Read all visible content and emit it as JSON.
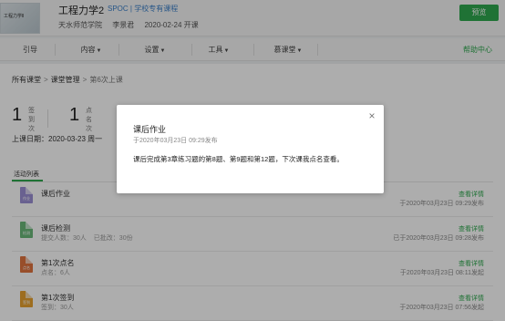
{
  "header": {
    "thumb_text": "工程力学Ⅱ",
    "course_title": "工程力学2",
    "spoc_tag": "SPOC | 学校专有课程",
    "school": "天水师范学院",
    "teacher": "李景君",
    "start": "2020-02-24 开课",
    "preview_label": "预览"
  },
  "nav": {
    "items": [
      "引导",
      "内容",
      "设置",
      "工具",
      "慕课堂"
    ],
    "help_label": "帮助中心"
  },
  "breadcrumb": {
    "root": "所有课堂",
    "mid": "课堂管理",
    "current": "第6次上课"
  },
  "stats": [
    {
      "num": "1",
      "l1": "签到",
      "l2": "次"
    },
    {
      "num": "1",
      "l1": "点名",
      "l2": "次"
    }
  ],
  "class_date": "上课日期：2020-03-23 周一",
  "tab_label": "活动列表",
  "activities": [
    {
      "icon_label": "作业",
      "color": "#9b8fd4",
      "title": "课后作业",
      "sub": [],
      "link": "查看详情",
      "time": "于2020年03月23日 09:29发布"
    },
    {
      "icon_label": "检测",
      "color": "#6ab97a",
      "title": "课后检测",
      "sub": [
        "提交人数：30人",
        "已批改：30份"
      ],
      "link": "查看详情",
      "time": "已于2020年03月23日 09:28发布"
    },
    {
      "icon_label": "点名",
      "color": "#e0733e",
      "title": "第1次点名",
      "sub": [
        "点名：6人"
      ],
      "link": "查看详情",
      "time": "于2020年03月23日 08:11发起"
    },
    {
      "icon_label": "签到",
      "color": "#e8a12f",
      "title": "第1次签到",
      "sub": [
        "签到：30人"
      ],
      "link": "查看详情",
      "time": "于2020年03月23日 07:56发起"
    }
  ],
  "modal": {
    "title": "课后作业",
    "date": "于2020年03月23日 09:29发布",
    "body": "课后完成第3章练习题的第8题、第9题和第12题，下次课我点名查看。",
    "close": "×"
  },
  "colors": {
    "accent": "#2fa84f",
    "link_blue": "#3a7fc8"
  }
}
